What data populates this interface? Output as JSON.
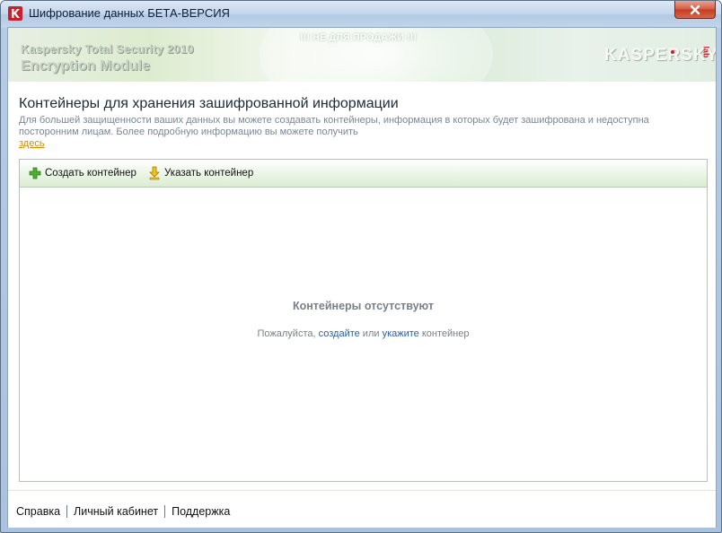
{
  "window": {
    "title": "Шифрование данных БЕТА-ВЕРСИЯ",
    "close_label": "✕"
  },
  "banner": {
    "product_line1": "Kaspersky Total Security 2010",
    "product_line2": "Encryption Module",
    "notice": "!!! НЕ ДЛЯ ПРОДАЖИ !!!",
    "logo": "KASPERSKY",
    "logo_lab": "lab"
  },
  "section": {
    "heading": "Контейнеры для хранения зашифрованной информации",
    "description": "Для большей защищенности ваших данных вы можете создавать контейнеры, информация в которых будет зашифрована и недоступна посторонним лицам. Более подробную информацию вы можете получить",
    "here_link": "здесь"
  },
  "toolbar": {
    "create_label": "Создать контейнер",
    "create_icon": "plus-icon",
    "specify_label": "Указать контейнер",
    "specify_icon": "arrow-down-icon"
  },
  "empty_state": {
    "title": "Контейнеры отсутствуют",
    "prefix": "Пожалуйста, ",
    "create_link": "создайте",
    "or_text": " или ",
    "specify_link": "укажите",
    "suffix": " контейнер"
  },
  "footer": {
    "help": "Справка",
    "account": "Личный кабинет",
    "support": "Поддержка"
  },
  "colors": {
    "accent_red": "#cc1f2c",
    "link_blue": "#2a5ea8",
    "link_orange": "#d88a00",
    "toolbar_green": "#dcedd3"
  }
}
